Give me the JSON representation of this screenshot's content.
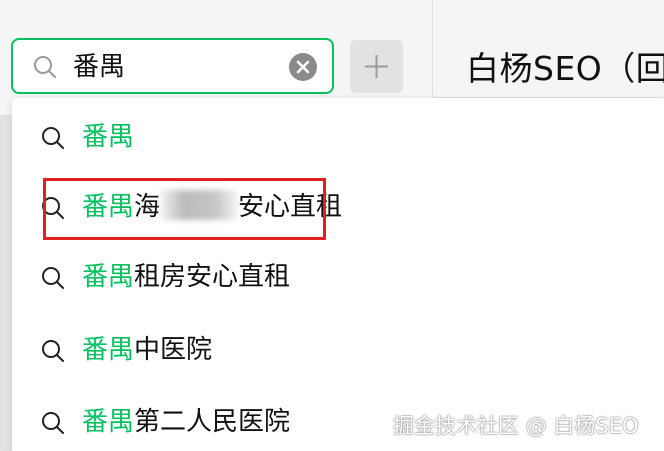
{
  "search": {
    "value": "番禺"
  },
  "chat": {
    "title": "白杨SEO（回"
  },
  "suggestions": [
    {
      "highlight": "番禺",
      "rest": "",
      "blurred": false
    },
    {
      "highlight": "番禺",
      "rest_before": "海",
      "rest": "安心直租",
      "blurred": true
    },
    {
      "highlight": "番禺",
      "rest": "租房安心直租",
      "blurred": false
    },
    {
      "highlight": "番禺",
      "rest": "中医院",
      "blurred": false
    },
    {
      "highlight": "番禺",
      "rest": "第二人民医院",
      "blurred": false
    }
  ],
  "watermark": "掘金技术社区 @ 白杨SEO",
  "colors": {
    "accent": "#07c160",
    "annotation": "#e02020"
  },
  "icons": {
    "search": "search-icon",
    "clear": "clear-icon",
    "add": "plus-icon"
  }
}
